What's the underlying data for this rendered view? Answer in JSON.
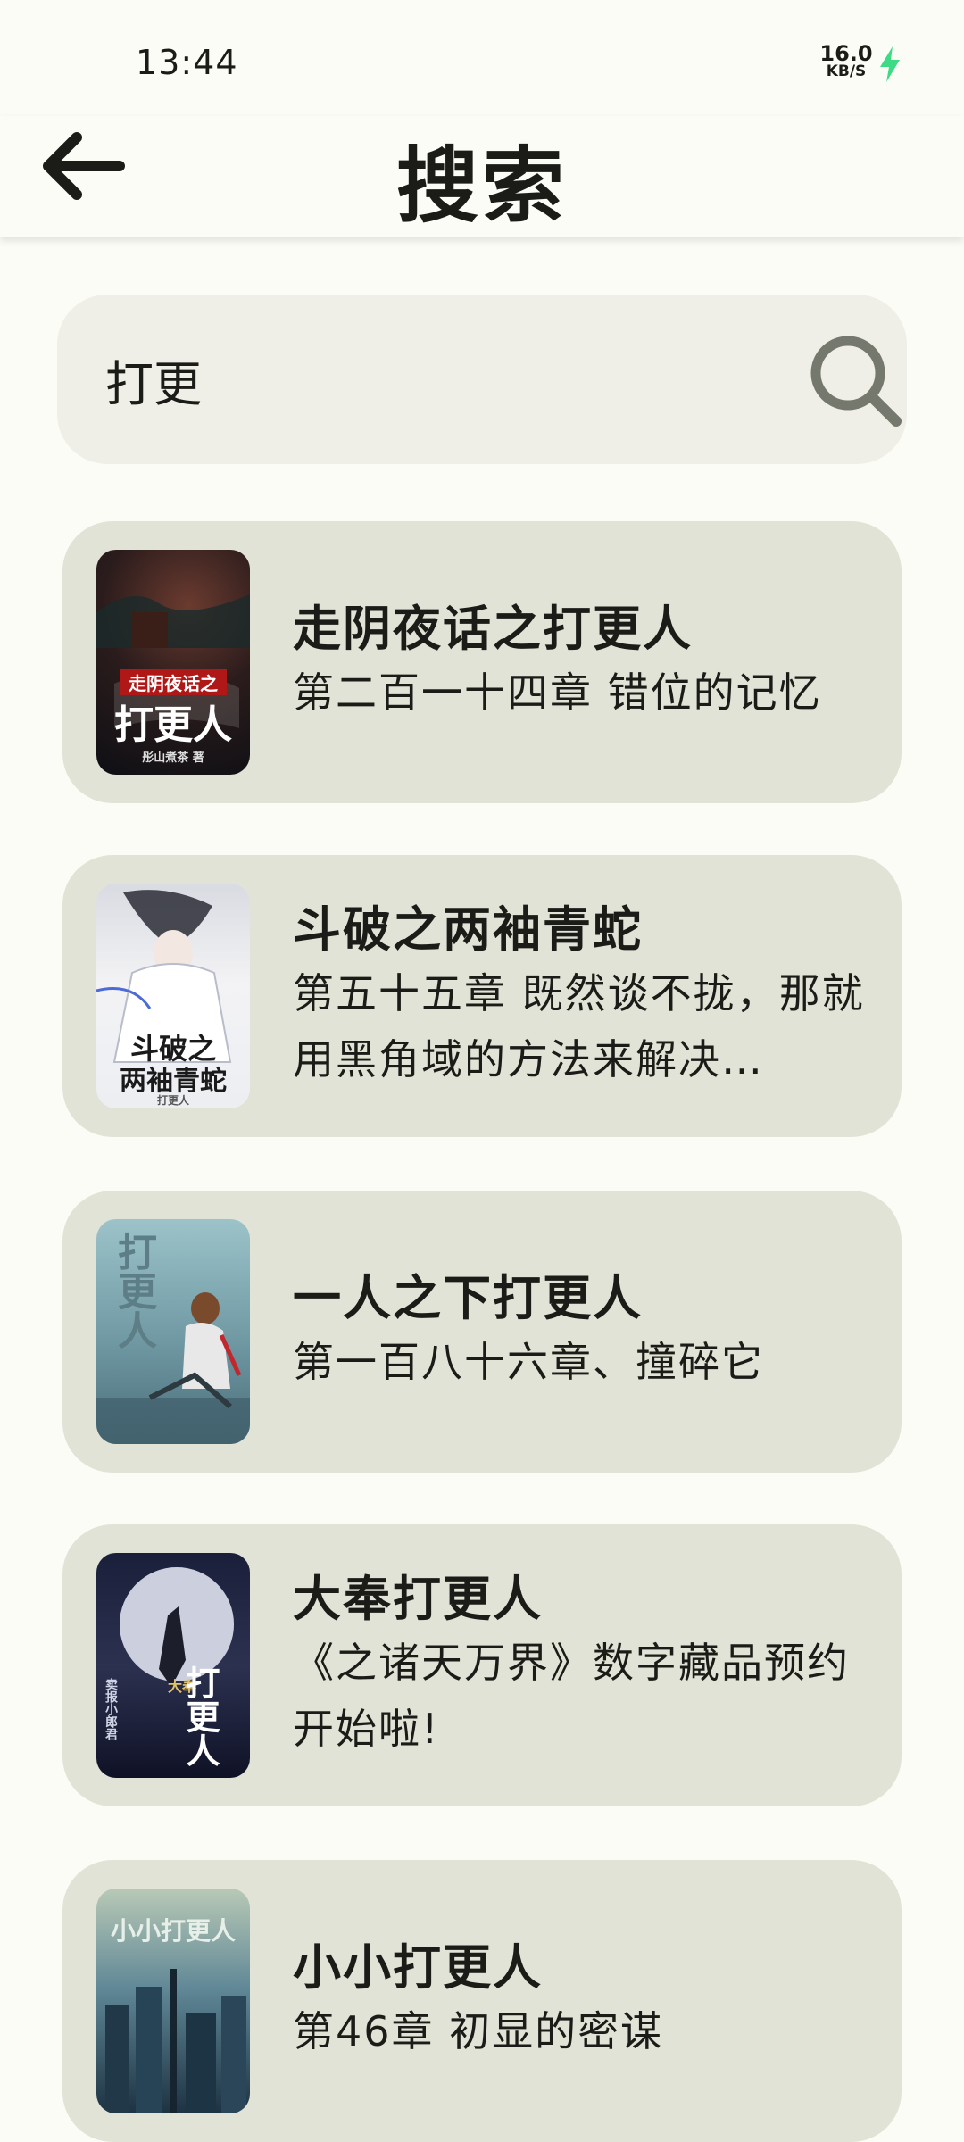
{
  "status_bar": {
    "time": "13:44",
    "net_speed_value": "16.0",
    "net_speed_unit": "KB/S",
    "charge_color": "#3ddc84"
  },
  "app_bar": {
    "title": "搜索",
    "back_icon": "arrow-left-icon"
  },
  "search": {
    "value": "打更",
    "icon": "search-icon"
  },
  "results": [
    {
      "title": "走阴夜话之打更人",
      "chapter": "第二百一十四章 错位的记忆",
      "cover": {
        "top_text": "走阴夜话之",
        "main_text": "打更人",
        "author_text": "彤山煮茶 著"
      }
    },
    {
      "title": "斗破之两袖青蛇",
      "chapter": "第五十五章 既然谈不拢，那就用黑角域的方法来解决…",
      "cover": {
        "top_text": "斗破之",
        "main_text": "两袖青蛇",
        "author_text": "打更人"
      }
    },
    {
      "title": "一人之下打更人",
      "chapter": "第一百八十六章、撞碎它",
      "cover": {
        "top_text": "",
        "main_text": "打更人",
        "author_text": ""
      }
    },
    {
      "title": "大奉打更人",
      "chapter": "《之诸天万界》数字藏品预约开始啦!",
      "cover": {
        "top_text": "大奉",
        "main_text": "打更人",
        "author_text": "卖报小郎君"
      }
    },
    {
      "title": "小小打更人",
      "chapter": "第46章 初显的密谋",
      "cover": {
        "top_text": "",
        "main_text": "小小打更人",
        "author_text": ""
      }
    }
  ]
}
